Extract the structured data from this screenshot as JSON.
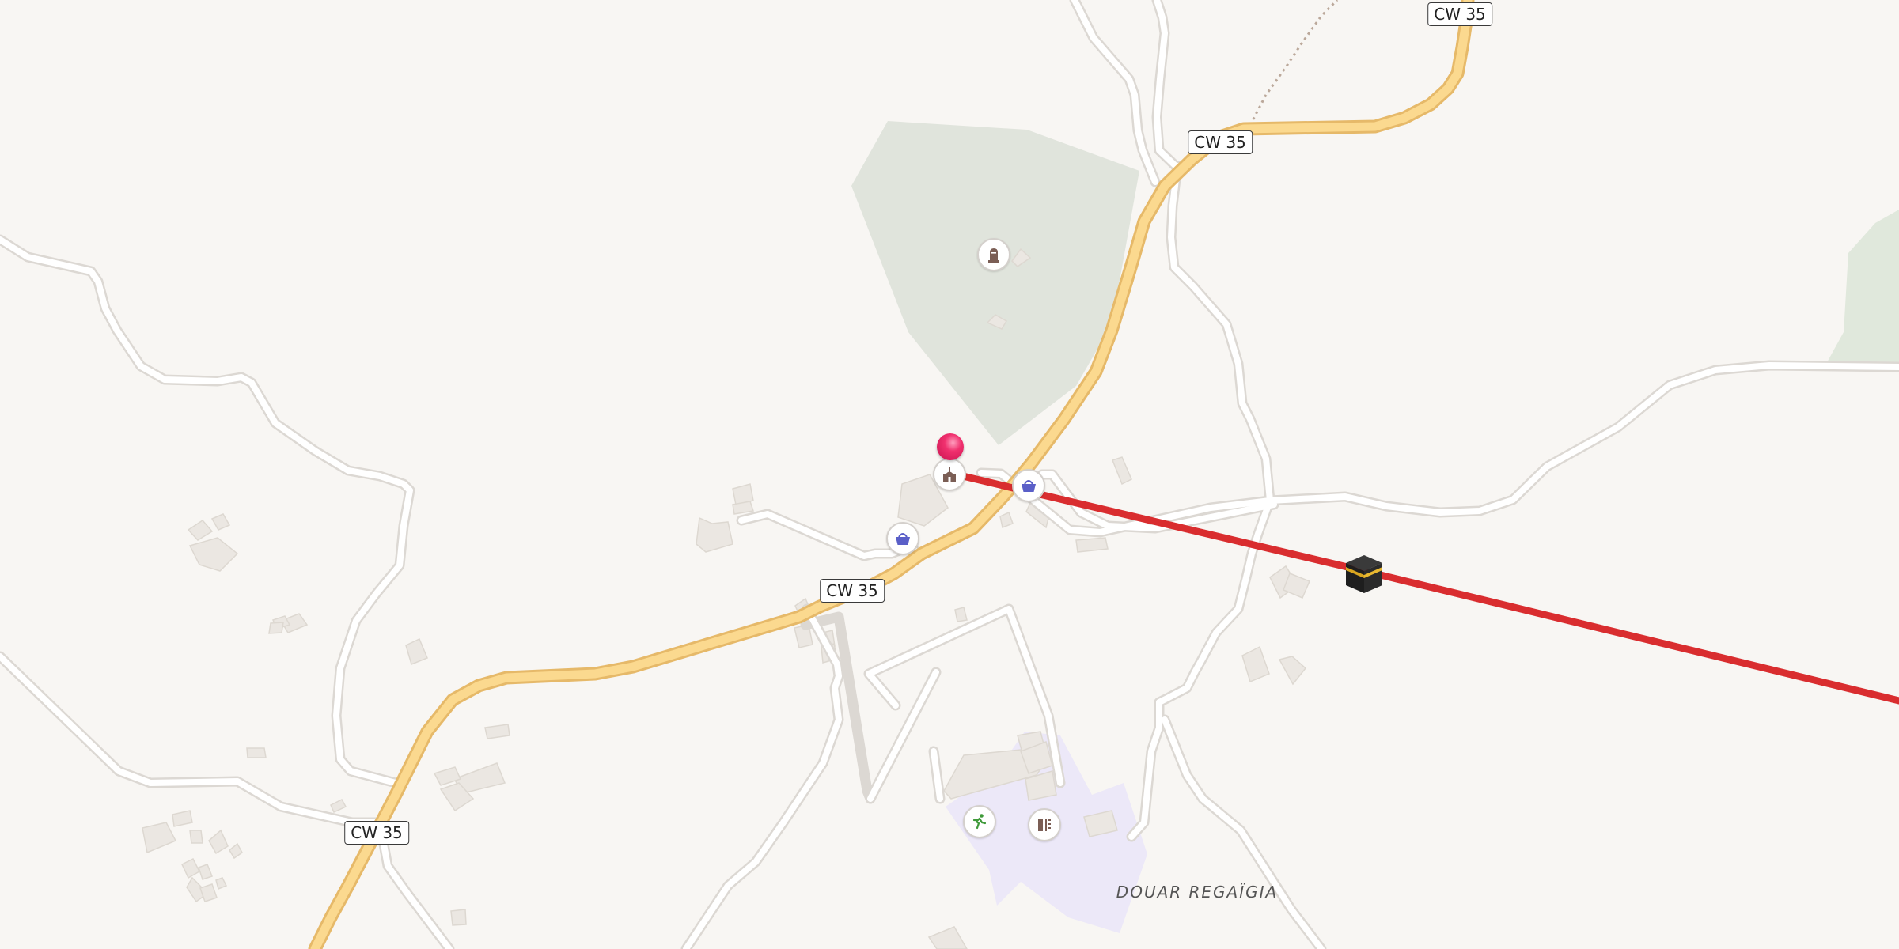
{
  "map": {
    "road_labels": [
      "CW 35",
      "CW 35",
      "CW 35",
      "CW 35"
    ],
    "place_label": "DOUAR REGAÏGIA",
    "colors": {
      "background": "#f8f6f3",
      "primary_road": "#fbd98f",
      "primary_road_casing": "#e6b969",
      "minor_road": "#ffffff",
      "minor_road_casing": "#dcd8d3",
      "wood_area": "#e0e4dc",
      "school_area": "#ece8f8",
      "building": "#ebe7e2",
      "route_line": "#d92d2f",
      "pin": "#e8225e"
    },
    "pois": [
      {
        "name": "cemetery",
        "icon": "grave-icon"
      },
      {
        "name": "mosque",
        "icon": "mosque-icon"
      },
      {
        "name": "shop",
        "icon": "shopping-basket-icon"
      },
      {
        "name": "shop",
        "icon": "shopping-basket-icon"
      },
      {
        "name": "sports",
        "icon": "running-person-icon"
      },
      {
        "name": "school",
        "icon": "school-icon"
      }
    ],
    "route_destination_icon": "kaaba-icon",
    "marker_icon": "location-pin-icon"
  }
}
